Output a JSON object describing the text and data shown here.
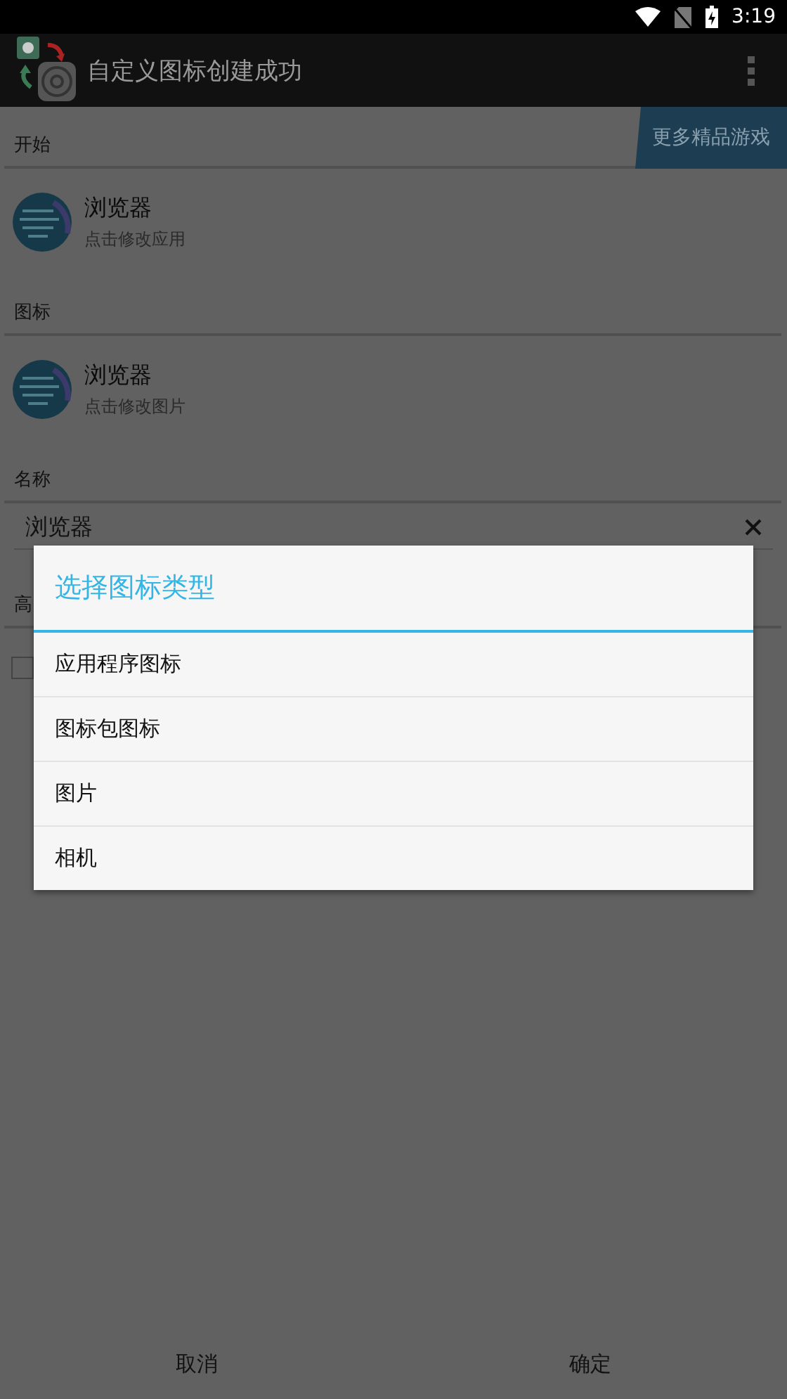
{
  "status_bar": {
    "time": "3:19"
  },
  "app_bar": {
    "title": "自定义图标创建成功"
  },
  "promo_badge": "更多精品游戏",
  "sections": [
    {
      "heading": "开始",
      "kind": "app",
      "title": "浏览器",
      "subtitle": "点击修改应用"
    },
    {
      "heading": "图标",
      "kind": "app",
      "title": "浏览器",
      "subtitle": "点击修改图片"
    },
    {
      "heading": "名称",
      "kind": "field",
      "value": "浏览器"
    },
    {
      "heading": "高",
      "kind": "checkbox",
      "checked": false
    }
  ],
  "dialog": {
    "title": "选择图标类型",
    "items": [
      "应用程序图标",
      "图标包图标",
      "图片",
      "相机"
    ]
  },
  "buttons": [
    "取消",
    "确定"
  ]
}
